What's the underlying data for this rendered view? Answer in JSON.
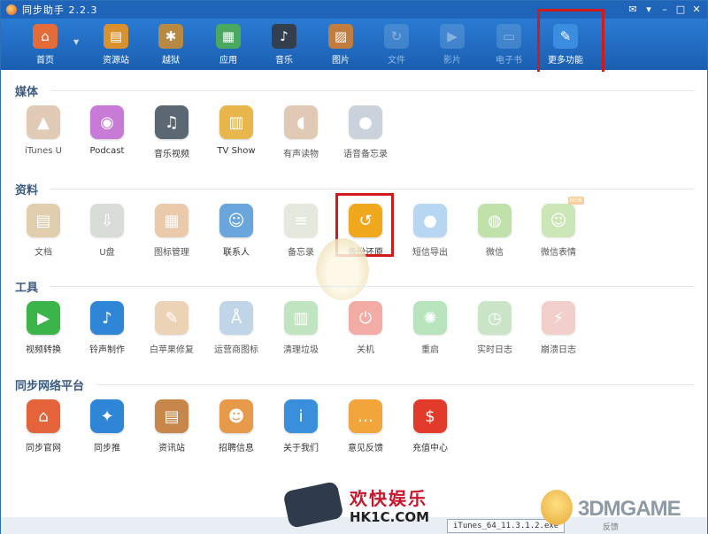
{
  "window": {
    "title": "同步助手 2.2.3"
  },
  "toolbar": {
    "items": [
      {
        "label": "首页",
        "icon": "home-icon",
        "color": "#e46b3a"
      },
      {
        "label": "资源站",
        "icon": "shopping-bag-icon",
        "color": "#d9902f"
      },
      {
        "label": "越狱",
        "icon": "pineapple-icon",
        "color": "#b78a44"
      },
      {
        "label": "应用",
        "icon": "apps-grid-icon",
        "color": "#4aa860"
      },
      {
        "label": "音乐",
        "icon": "music-note-icon",
        "color": "#333f4c"
      },
      {
        "label": "图片",
        "icon": "picture-icon",
        "color": "#c27c3e"
      },
      {
        "label": "文件",
        "icon": "file-icon",
        "color": "#6aa0d8"
      },
      {
        "label": "影片",
        "icon": "movie-icon",
        "color": "#6aa0d8"
      },
      {
        "label": "电子书",
        "icon": "ebook-icon",
        "color": "#6aa0d8"
      },
      {
        "label": "更多功能",
        "icon": "tools-icon",
        "color": "#3b8de0"
      }
    ]
  },
  "sections": [
    {
      "title": "媒体",
      "apps": [
        {
          "label": "iTunes U",
          "icon": "graduation-cap-icon",
          "color": "#c9a27b"
        },
        {
          "label": "Podcast",
          "icon": "podcast-icon",
          "color": "#c77ad6"
        },
        {
          "label": "音乐视频",
          "icon": "music-video-icon",
          "color": "#5b6773"
        },
        {
          "label": "TV Show",
          "icon": "tv-show-icon",
          "color": "#e8b64a"
        },
        {
          "label": "有声读物",
          "icon": "audiobook-icon",
          "color": "#c8a07a"
        },
        {
          "label": "语音备忘录",
          "icon": "microphone-icon",
          "color": "#9fb0c0"
        }
      ]
    },
    {
      "title": "资料",
      "apps": [
        {
          "label": "文档",
          "icon": "document-icon",
          "color": "#c9a76e"
        },
        {
          "label": "U盘",
          "icon": "usb-drive-icon",
          "color": "#b9c4b8"
        },
        {
          "label": "图标管理",
          "icon": "icon-grid-icon",
          "color": "#d9a066"
        },
        {
          "label": "联系人",
          "icon": "contacts-icon",
          "color": "#6aa6dc"
        },
        {
          "label": "备忘录",
          "icon": "notes-icon",
          "color": "#cfd6c2"
        },
        {
          "label": "备份还原",
          "icon": "backup-restore-icon",
          "color": "#f0a81c"
        },
        {
          "label": "短信导出",
          "icon": "sms-export-icon",
          "color": "#7db6e8"
        },
        {
          "label": "微信",
          "icon": "wechat-icon",
          "color": "#8fc968"
        },
        {
          "label": "微信表情",
          "icon": "wechat-emoji-icon",
          "color": "#a6d27d",
          "badge": "NEW"
        }
      ]
    },
    {
      "title": "工具",
      "apps": [
        {
          "label": "视频转换",
          "icon": "video-convert-icon",
          "color": "#3bb54a"
        },
        {
          "label": "铃声制作",
          "icon": "ringtone-bell-icon",
          "color": "#2f86d6"
        },
        {
          "label": "白苹果修复",
          "icon": "wrench-icon",
          "color": "#e0b07a"
        },
        {
          "label": "运营商图标",
          "icon": "signal-tower-icon",
          "color": "#8fb3d8"
        },
        {
          "label": "清理垃圾",
          "icon": "trash-icon",
          "color": "#8fcf8f"
        },
        {
          "label": "关机",
          "icon": "power-icon",
          "color": "#e86a5c"
        },
        {
          "label": "重启",
          "icon": "restart-icon",
          "color": "#7fcf88"
        },
        {
          "label": "实时日志",
          "icon": "realtime-log-icon",
          "color": "#9fd09a"
        },
        {
          "label": "崩溃日志",
          "icon": "crash-log-icon",
          "color": "#e9a9a0"
        }
      ]
    },
    {
      "title": "同步网络平台",
      "apps": [
        {
          "label": "同步官网",
          "icon": "home-icon",
          "color": "#e5633b"
        },
        {
          "label": "同步推",
          "icon": "tongbu-push-icon",
          "color": "#2f86d6"
        },
        {
          "label": "资讯站",
          "icon": "news-icon",
          "color": "#c8874a"
        },
        {
          "label": "招聘信息",
          "icon": "recruit-icon",
          "color": "#e79a4a"
        },
        {
          "label": "关于我们",
          "icon": "info-icon",
          "color": "#3a8fdc"
        },
        {
          "label": "意见反馈",
          "icon": "feedback-icon",
          "color": "#f2a53a"
        },
        {
          "label": "充值中心",
          "icon": "recharge-icon",
          "color": "#e23b2c"
        }
      ]
    }
  ],
  "ad": {
    "title": "欢快娱乐",
    "url": "HK1C.COM"
  },
  "statusbar": {
    "task": "iTunes_64_11.3.1.2.exe",
    "text": "反馈"
  },
  "watermark": {
    "text": "3DMGAME"
  }
}
